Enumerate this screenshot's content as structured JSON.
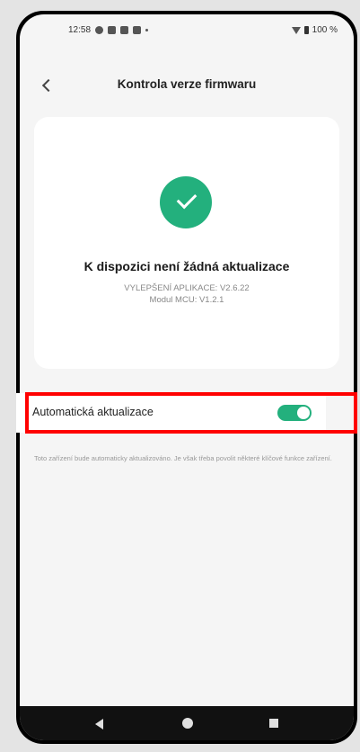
{
  "statusbar": {
    "time": "12:58",
    "battery": "100 %"
  },
  "header": {
    "title": "Kontrola verze firmwaru"
  },
  "card": {
    "status": "K dispozici není žádná aktualizace",
    "app_version": "VYLEPŠENÍ APLIKACE: V2.6.22",
    "module_version": "Modul MCU: V1.2.1"
  },
  "auto_update": {
    "label": "Automatická aktualizace",
    "enabled": true,
    "description": "Toto zařízení bude automaticky aktualizováno. Je však třeba povolit některé klíčové funkce zařízení."
  },
  "colors": {
    "accent": "#23b07d",
    "highlight": "#ff0000"
  },
  "icons": [
    "back-icon",
    "check-icon",
    "wifi-icon",
    "battery-icon",
    "nav-back-icon",
    "nav-home-icon",
    "nav-recent-icon"
  ]
}
